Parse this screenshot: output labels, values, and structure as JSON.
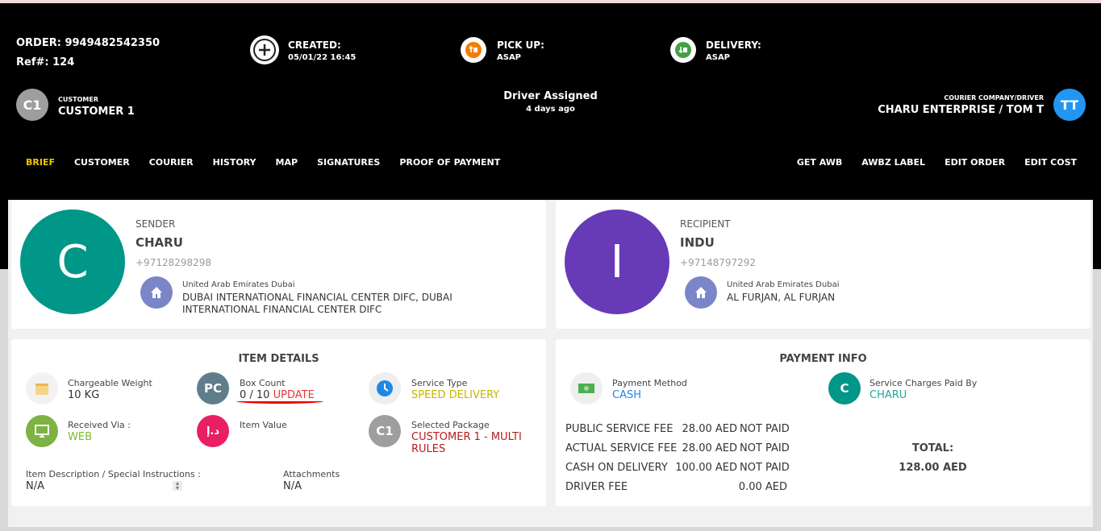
{
  "order": {
    "order_label": "ORDER: 9949482542350",
    "ref_label": "Ref#: 124"
  },
  "statuses": {
    "created_label": "CREATED:",
    "created_value": "05/01/22 16:45",
    "pickup_label": "PICK UP:",
    "pickup_value": "ASAP",
    "delivery_label": "DELIVERY:",
    "delivery_value": "ASAP"
  },
  "customer": {
    "initials": "C1",
    "caption": "CUSTOMER",
    "name": "CUSTOMER 1"
  },
  "driver_status": {
    "title": "Driver Assigned",
    "when": "4 days ago"
  },
  "courier": {
    "caption": "COURIER COMPANY/DRIVER",
    "name": "CHARU ENTERPRISE / TOM T",
    "initials": "TT"
  },
  "tabs": [
    "BRIEF",
    "CUSTOMER",
    "COURIER",
    "HISTORY",
    "MAP",
    "SIGNATURES",
    "PROOF OF PAYMENT"
  ],
  "actions": [
    "GET AWB",
    "AWBZ LABEL",
    "EDIT ORDER",
    "EDIT COST"
  ],
  "sender": {
    "initial": "C",
    "label": "SENDER",
    "name": "CHARU",
    "phone": "+97128298298",
    "region": "United Arab Emirates Dubai",
    "address_line1": "DUBAI INTERNATIONAL FINANCIAL CENTER DIFC, DUBAI",
    "address_line2": "INTERNATIONAL FINANCIAL CENTER DIFC"
  },
  "recipient": {
    "initial": "I",
    "label": "RECIPIENT",
    "name": "INDU",
    "phone": "+97148797292",
    "region": "United Arab Emirates Dubai",
    "address_line1": "AL FURJAN, AL FURJAN"
  },
  "item_details": {
    "title": "ITEM DETAILS",
    "weight_label": "Chargeable Weight",
    "weight_value": "10 KG",
    "box_icon": "PC",
    "box_label": "Box Count",
    "box_value": "0 / 10",
    "box_update": "UPDATE",
    "service_label": "Service Type",
    "service_value": "SPEED DELIVERY",
    "received_label": "Received Via :",
    "received_value": "WEB",
    "value_icon": "د.إ",
    "value_label": "Item Value",
    "package_icon": "C1",
    "package_label": "Selected Package",
    "package_value_line1": "CUSTOMER 1 - MULTI",
    "package_value_line2": "RULES",
    "desc_label": "Item Description / Special Instructions :",
    "desc_value": "N/A",
    "attach_label": "Attachments",
    "attach_value": "N/A"
  },
  "payment_info": {
    "title": "PAYMENT INFO",
    "method_label": "Payment Method",
    "method_value": "CASH",
    "paidby_icon": "C",
    "paidby_label": "Service Charges Paid By",
    "paidby_value": "CHARU",
    "fees": [
      {
        "label": "PUBLIC SERVICE FEE",
        "amount": "28.00 AED",
        "status": "NOT PAID"
      },
      {
        "label": "ACTUAL SERVICE FEE",
        "amount": "28.00 AED",
        "status": "NOT PAID"
      },
      {
        "label": "CASH ON DELIVERY",
        "amount": "100.00 AED",
        "status": "NOT PAID"
      },
      {
        "label": "DRIVER FEE",
        "amount": "0.00 AED",
        "status": ""
      }
    ],
    "total_label": "TOTAL:",
    "total_value": "128.00 AED"
  },
  "colors": {
    "header_bg": "#000000",
    "active_tab": "#f6c400",
    "sender_avatar": "#009688",
    "recipient_avatar": "#673ab7",
    "courier_avatar": "#2196f3",
    "not_paid": "#e53935"
  }
}
